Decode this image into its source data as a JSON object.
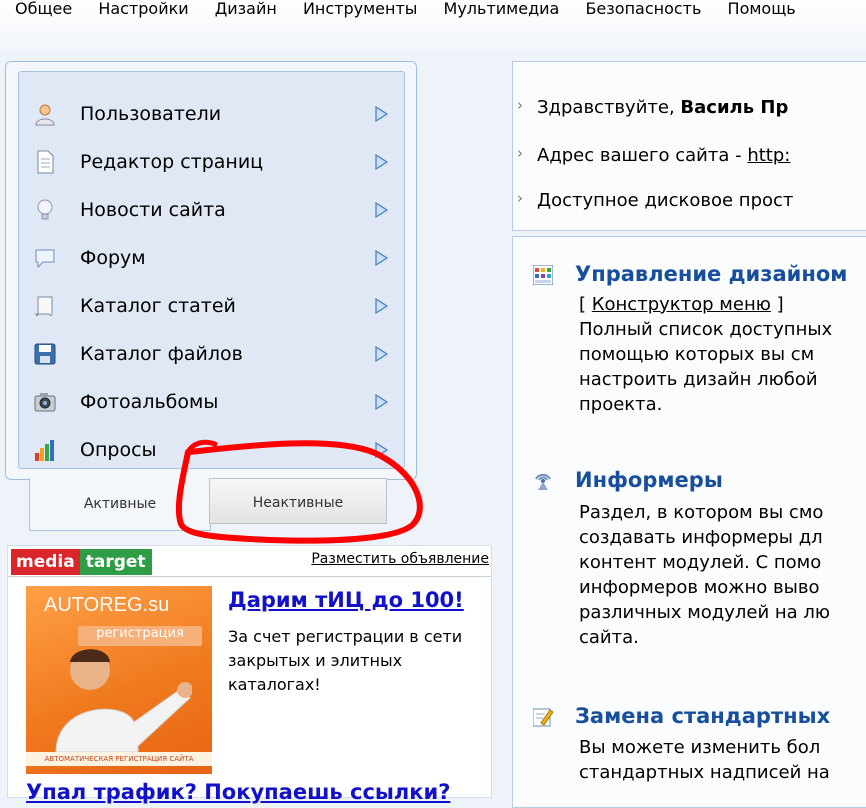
{
  "topmenu": [
    "Общее",
    "Настройки",
    "Дизайн",
    "Инструменты",
    "Мультимедиа",
    "Безопасность",
    "Помощь"
  ],
  "modules": [
    {
      "label": "Пользователи",
      "icon": "user-icon"
    },
    {
      "label": "Редактор страниц",
      "icon": "page-icon"
    },
    {
      "label": "Новости сайта",
      "icon": "lightbulb-icon"
    },
    {
      "label": "Форум",
      "icon": "speech-bubble-icon"
    },
    {
      "label": "Каталог статей",
      "icon": "scroll-icon"
    },
    {
      "label": "Каталог файлов",
      "icon": "floppy-disk-icon"
    },
    {
      "label": "Фотоальбомы",
      "icon": "camera-icon"
    },
    {
      "label": "Опросы",
      "icon": "bar-chart-icon"
    }
  ],
  "tabs": {
    "active": "Активные",
    "inactive": "Неактивные"
  },
  "ad": {
    "logo_part1": "media",
    "logo_part2": "target",
    "place_link": "Разместить объявление",
    "image_brand": "AUTOREG.su",
    "image_reg": "регистрация",
    "image_strip": "АВТОМАТИЧЕСКАЯ РЕГИСТРАЦИЯ САЙТА",
    "title": "Дарим тИЦ до 100!",
    "text": "За счет регистрации в сети закрытых и элитных каталогах!",
    "bottom_link": "Упал трафик? Покупаешь ссылки?"
  },
  "info": {
    "greeting_prefix": "Здравствуйте, ",
    "greeting_name": "Василь Пр",
    "address_prefix": "Адрес вашего сайта - ",
    "address_link": "http:",
    "disk": "Доступное дисковое прост"
  },
  "sections": {
    "design_title": "Управление дизайном",
    "design_link": "Конструктор меню",
    "design_line1": "Полный список доступных",
    "design_line2": "помощью которых вы см",
    "design_line3": "настроить дизайн любой",
    "design_line4": "проекта.",
    "informers_title": "Информеры",
    "informers_line1": "Раздел, в котором вы смо",
    "informers_line2": "создавать информеры дл",
    "informers_line3": "контент модулей. С помо",
    "informers_line4": "информеров можно выво",
    "informers_line5": "различных модулей на лю",
    "informers_line6": "сайта.",
    "replace_title": "Замена стандартных",
    "replace_line1": "Вы можете изменить бол",
    "replace_line2": "стандартных надписей на"
  },
  "colors": {
    "annotation": "#ff0000",
    "heading": "#174f9d",
    "link": "#1111cc"
  }
}
